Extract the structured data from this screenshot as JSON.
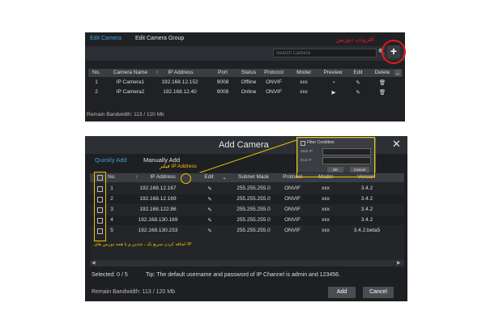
{
  "top_panel": {
    "tabs": [
      "Edit Camera",
      "Edit Camera Group"
    ],
    "search_placeholder": "Search Camera",
    "add_annotation": "افزودن دوربین",
    "columns": [
      "No.",
      "Camera Name",
      "IP Address",
      "Port",
      "Status",
      "Protocol",
      "Model",
      "Preview",
      "Edit",
      "Delete"
    ],
    "rows": [
      {
        "no": "1",
        "name": "IP Camera1",
        "ip": "192.168.12.152",
        "port": "9008",
        "status": "Offline",
        "protocol": "ONVIF",
        "model": "xxx"
      },
      {
        "no": "2",
        "name": "IP Camera2",
        "ip": "192.168.12.40",
        "port": "9008",
        "status": "Online",
        "protocol": "ONVIF",
        "model": "xxx"
      }
    ],
    "remain_bandwidth": "Remain Bandwidth: 113 / 120 Mb"
  },
  "dialog": {
    "title": "Add Camera",
    "tabs": [
      "Quickly Add",
      "Manually Add"
    ],
    "filter_popup": {
      "title": "Filter Condition",
      "start_label": "Start IP",
      "end_label": "End IP",
      "ok": "OK",
      "cancel": "Cancel"
    },
    "ip_filter_annotation": "فیلتر IP Address",
    "columns": [
      "No.",
      "IP Address",
      "Edit",
      "Subnet Mask",
      "Protocol",
      "Model",
      "Version"
    ],
    "rows": [
      {
        "no": "1",
        "ip": "192.168.12.167",
        "mask": "255.255.255.0",
        "protocol": "ONVIF",
        "model": "xxx",
        "version": "3.4.2"
      },
      {
        "no": "2",
        "ip": "192.168.12.169",
        "mask": "255.255.255.0",
        "protocol": "ONVIF",
        "model": "xxx",
        "version": "3.4.2"
      },
      {
        "no": "3",
        "ip": "192.168.122.86",
        "mask": "255.255.255.0",
        "protocol": "ONVIF",
        "model": "xxx",
        "version": "3.4.2"
      },
      {
        "no": "4",
        "ip": "192.168.130.169",
        "mask": "255.255.255.0",
        "protocol": "ONVIF",
        "model": "xxx",
        "version": "3.4.2"
      },
      {
        "no": "5",
        "ip": "192.168.130.233",
        "mask": "255.255.255.0",
        "protocol": "ONVIF",
        "model": "xxx",
        "version": "3.4.2.beta5"
      }
    ],
    "batch_annotation": "اضافه کردن سریع یک ، چندین و یا همه دوربین های IP",
    "selected": "Selected: 0 / 5",
    "tip": "Tip: The default username and password of IP Channel is admin and 123456.",
    "remain_bandwidth": "Remain Bandwidth: 113 / 120 Mb",
    "add_label": "Add",
    "cancel_label": "Cancel"
  },
  "colors": {
    "accent": "#3aa0e0",
    "annotation_red": "#e21b1b",
    "annotation_yellow": "#f2c200"
  }
}
